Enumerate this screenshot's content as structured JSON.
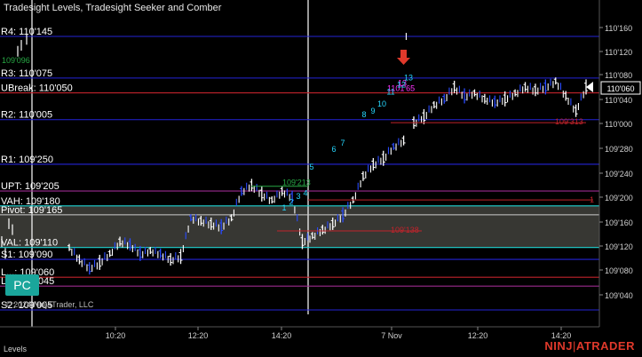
{
  "window": {
    "title": "Tradesight Levels, Tradesight Seeker and Comber",
    "copyright": "© 2024 NinjaTrader, LLC",
    "tab_label": "Levels",
    "brand_left": "NINJ",
    "brand_sep": "|",
    "brand_right": "ATRADER",
    "pc_button": "PC"
  },
  "colors": {
    "background": "#000000",
    "level_blue": "#2323d6",
    "level_red": "#c0232b",
    "level_purple": "#9a2b8e",
    "level_cyan": "#1fd3d3",
    "value_area_fill": "#4a4a44",
    "bar_white": "#ffffff",
    "bar_blue": "#2a4bff",
    "seeker_green": "#27a844",
    "seeker_cyan": "#26d7ff",
    "comber_magenta": "#ff33ff",
    "arrow_red": "#e0392b",
    "brand_red": "#e0392b"
  },
  "levels": [
    {
      "label": "R4: 110'145",
      "price": 110.145,
      "color": "#2323d6"
    },
    {
      "label": "R3: 110'075",
      "price": 110.075,
      "color": "#2323d6"
    },
    {
      "label": "UBreak: 110'050",
      "price": 110.05,
      "color": "#c0232b"
    },
    {
      "label": "R2: 110'005",
      "price": 110.005,
      "color": "#2323d6"
    },
    {
      "label": "R1: 109'250",
      "price": 109.25,
      "color": "#2323d6"
    },
    {
      "label": "UPT: 109'205",
      "price": 109.205,
      "color": "#9a2b8e"
    },
    {
      "label": "VAH: 109'180",
      "price": 109.18,
      "color": "#1fd3d3"
    },
    {
      "label": "Pivot: 109'165",
      "price": 109.165,
      "color": "#cccccc"
    },
    {
      "label": "VAL: 109'110",
      "price": 109.11,
      "color": "#1fd3d3"
    },
    {
      "label": "S1: 109'090",
      "price": 109.09,
      "color": "#2323d6"
    },
    {
      "label": "L...: 109'060",
      "price": 109.06,
      "color": "#c0232b"
    },
    {
      "label": "L...: 109'045",
      "price": 109.045,
      "color": "#9a2b8e"
    },
    {
      "label": "S2: 109'005",
      "price": 109.005,
      "color": "#2323d6"
    }
  ],
  "price_axis": {
    "ticks": [
      "110'160",
      "110'120",
      "110'080",
      "110'040",
      "110'000",
      "109'280",
      "109'240",
      "109'200",
      "109'160",
      "109'120",
      "109'080",
      "109'040"
    ],
    "current_price": "110'060"
  },
  "time_axis": {
    "ticks": [
      "10:20",
      "12:20",
      "14:20",
      "7 Nov",
      "12:20",
      "14:20"
    ]
  },
  "annotations": {
    "zone_top": "109'213",
    "zone_bottom": "109'138",
    "resistance": "109'313",
    "comber": "1101'65",
    "comber_count": "13",
    "right_edge_marker": "1",
    "left_clip": "109'096"
  },
  "chart_data": {
    "type": "ohlc",
    "title": "Tradesight Levels, Tradesight Seeker and Comber",
    "x": [
      "10:20",
      "12:20",
      "14:20",
      "7 Nov",
      "12:20",
      "14:20"
    ],
    "y_ticks": [
      "110'160",
      "110'120",
      "110'080",
      "110'040",
      "110'000",
      "109'280",
      "109'240",
      "109'200",
      "109'160",
      "109'120",
      "109'080",
      "109'040"
    ],
    "series": [
      {
        "name": "Price",
        "values": [
          109.11,
          109.09,
          109.075,
          109.085,
          109.1,
          109.12,
          109.115,
          109.1,
          109.105,
          109.1,
          109.09,
          109.095,
          109.16,
          109.155,
          109.15,
          109.145,
          109.16,
          109.205,
          109.215,
          109.2,
          109.19,
          109.205,
          109.195,
          109.12,
          109.13,
          109.14,
          109.15,
          109.165,
          109.19,
          109.23,
          109.25,
          109.26,
          109.28,
          109.29,
          110.0,
          110.01,
          110.03,
          110.04,
          110.06,
          110.045,
          110.05,
          110.04,
          110.035,
          110.04,
          110.05,
          110.06,
          110.055,
          110.06,
          110.07,
          110.045,
          110.02,
          110.06
        ]
      }
    ],
    "seeker_counts_up": [
      "1",
      "2",
      "3",
      "4",
      "5",
      "6",
      "7",
      "8",
      "9",
      "10",
      "11",
      "12",
      "13"
    ],
    "grid": true,
    "legend": "none"
  }
}
